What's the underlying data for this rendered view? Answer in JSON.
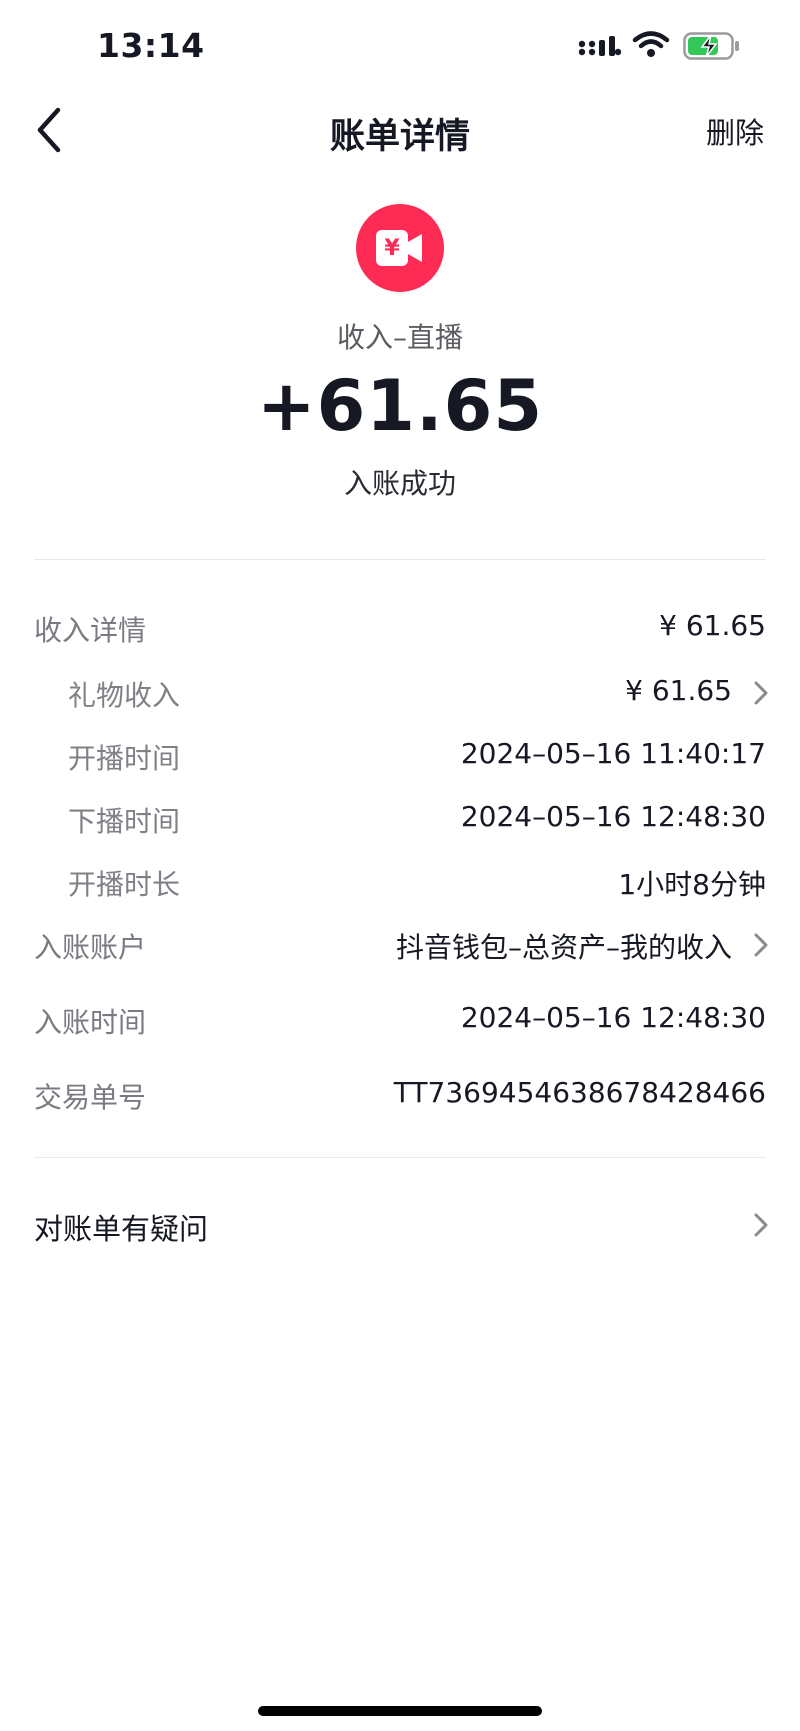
{
  "status_bar": {
    "time": "13:14",
    "signal_icon": "signal-icon",
    "wifi_icon": "wifi-icon",
    "battery_icon": "battery-charging-icon",
    "battery_color": "#34c759"
  },
  "nav": {
    "back_icon": "chevron-left-icon",
    "title": "账单详情",
    "delete_label": "删除"
  },
  "summary": {
    "icon": "live-yuan-camera-icon",
    "icon_glyph": "¥",
    "icon_color": "#fe2c55",
    "category": "收入–直播",
    "amount": "+61.65",
    "status": "入账成功"
  },
  "details": {
    "income_detail": {
      "label": "收入详情",
      "value": "¥ 61.65"
    },
    "gift_income": {
      "label": "礼物收入",
      "value": "¥ 61.65"
    },
    "start_time": {
      "label": "开播时间",
      "value": "2024–05–16 11:40:17"
    },
    "end_time": {
      "label": "下播时间",
      "value": "2024–05–16 12:48:30"
    },
    "duration": {
      "label": "开播时长",
      "value": "1小时8分钟"
    },
    "account": {
      "label": "入账账户",
      "value": "抖音钱包–总资产–我的收入"
    },
    "credit_time": {
      "label": "入账时间",
      "value": "2024–05–16 12:48:30"
    },
    "order_no": {
      "label": "交易单号",
      "value": "TT7369454638678428466"
    }
  },
  "question": {
    "label": "对账单有疑问"
  }
}
